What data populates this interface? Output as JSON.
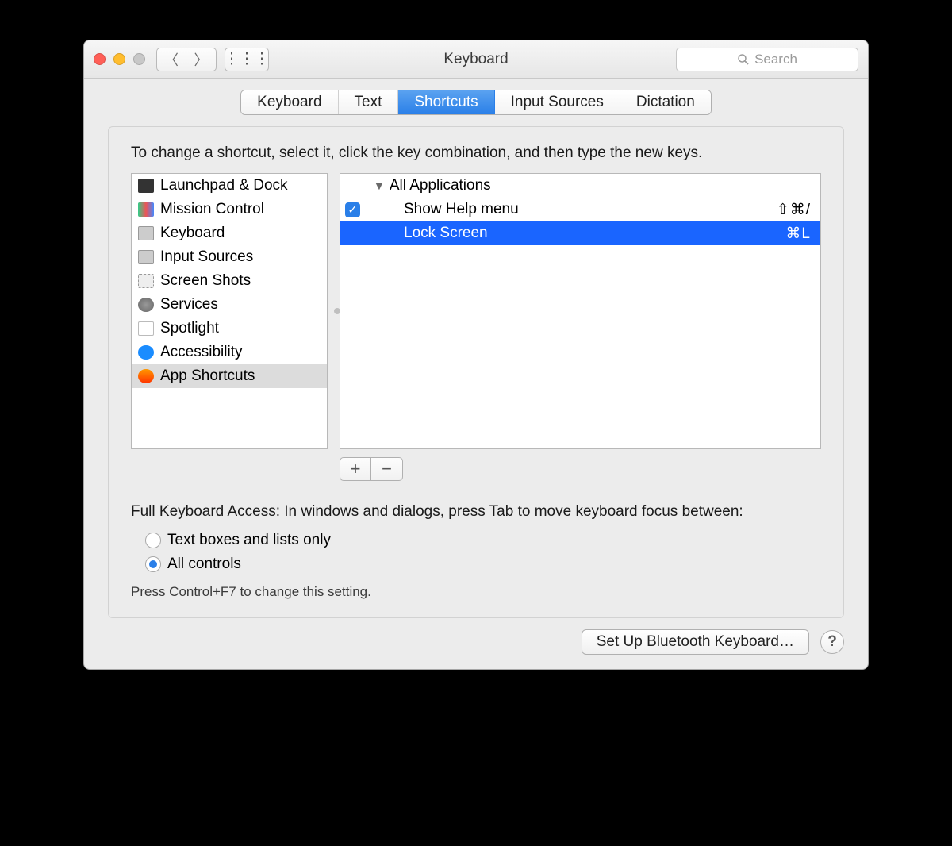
{
  "window": {
    "title": "Keyboard"
  },
  "toolbar": {
    "search_placeholder": "Search"
  },
  "tabs": {
    "items": [
      "Keyboard",
      "Text",
      "Shortcuts",
      "Input Sources",
      "Dictation"
    ],
    "active_index": 2
  },
  "instructions": "To change a shortcut, select it, click the key combination, and then type the new keys.",
  "categories": [
    {
      "label": "Launchpad & Dock",
      "icon": "launchpad"
    },
    {
      "label": "Mission Control",
      "icon": "mission"
    },
    {
      "label": "Keyboard",
      "icon": "kbd"
    },
    {
      "label": "Input Sources",
      "icon": "input"
    },
    {
      "label": "Screen Shots",
      "icon": "screen"
    },
    {
      "label": "Services",
      "icon": "serv"
    },
    {
      "label": "Spotlight",
      "icon": "spot"
    },
    {
      "label": "Accessibility",
      "icon": "acc"
    },
    {
      "label": "App Shortcuts",
      "icon": "app",
      "selected": true
    }
  ],
  "detail": {
    "group": "All Applications",
    "items": [
      {
        "enabled": true,
        "label": "Show Help menu",
        "shortcut": "⇧⌘/",
        "selected": false
      },
      {
        "enabled": true,
        "label": "Lock Screen",
        "shortcut": "⌘L",
        "selected": true
      }
    ]
  },
  "add_remove": {
    "add": "+",
    "remove": "−"
  },
  "fka": {
    "heading": "Full Keyboard Access: In windows and dialogs, press Tab to move keyboard focus between:",
    "options": [
      "Text boxes and lists only",
      "All controls"
    ],
    "selected_index": 1,
    "hint": "Press Control+F7 to change this setting."
  },
  "footer": {
    "bluetooth_button": "Set Up Bluetooth Keyboard…",
    "help": "?"
  }
}
